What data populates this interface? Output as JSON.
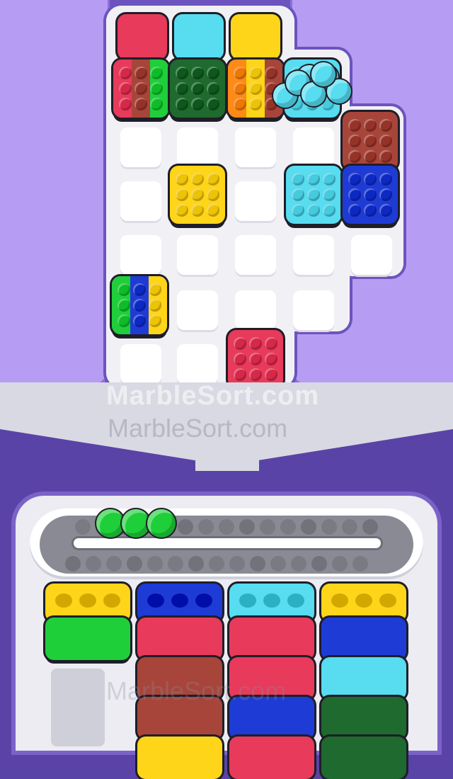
{
  "game": {
    "watermark_bold": "MarbleSort.com",
    "watermark_light": "MarbleSort.com",
    "watermark_bottom": "MarbleSort.com",
    "colors": {
      "red": "#e83a5a",
      "cyan": "#57dcf0",
      "yellow": "#ffd51a",
      "green": "#1fcf3a",
      "dark_green": "#1f6a2e",
      "brown": "#a8453a",
      "blue": "#1f3bd6",
      "orange": "#ff8a16"
    },
    "top_caps": [
      "red",
      "cyan",
      "yellow"
    ],
    "conveyor_marbles": [
      "green",
      "green",
      "green"
    ],
    "loose_marbles": [
      "cyan",
      "cyan",
      "cyan",
      "cyan",
      "cyan",
      "cyan",
      "cyan"
    ],
    "tiles": [
      {
        "name": "tile-multicolor-red-brown-green",
        "colors": [
          "red",
          "brown",
          "green"
        ]
      },
      {
        "name": "tile-dark-green",
        "colors": [
          "dark_green"
        ]
      },
      {
        "name": "tile-multicolor-orange-yellow-brown",
        "colors": [
          "orange",
          "yellow",
          "brown"
        ]
      },
      {
        "name": "tile-cyan-top",
        "colors": [
          "cyan"
        ]
      },
      {
        "name": "tile-brown",
        "colors": [
          "brown"
        ]
      },
      {
        "name": "tile-yellow",
        "colors": [
          "yellow"
        ]
      },
      {
        "name": "tile-cyan",
        "colors": [
          "cyan"
        ]
      },
      {
        "name": "tile-blue",
        "colors": [
          "blue"
        ]
      },
      {
        "name": "tile-multicolor-green-blue-yellow",
        "colors": [
          "green",
          "blue",
          "yellow"
        ]
      },
      {
        "name": "tile-red",
        "colors": [
          "red"
        ]
      }
    ],
    "columns": [
      {
        "name": "column-1",
        "blocks": [
          "yellow",
          "green"
        ]
      },
      {
        "name": "column-2",
        "blocks": [
          "blue",
          "red",
          "brown",
          "brown",
          "yellow"
        ]
      },
      {
        "name": "column-3",
        "blocks": [
          "cyan",
          "red",
          "red",
          "blue",
          "red"
        ]
      },
      {
        "name": "column-4",
        "blocks": [
          "yellow",
          "blue",
          "cyan",
          "dark_green",
          "dark_green"
        ]
      }
    ]
  }
}
